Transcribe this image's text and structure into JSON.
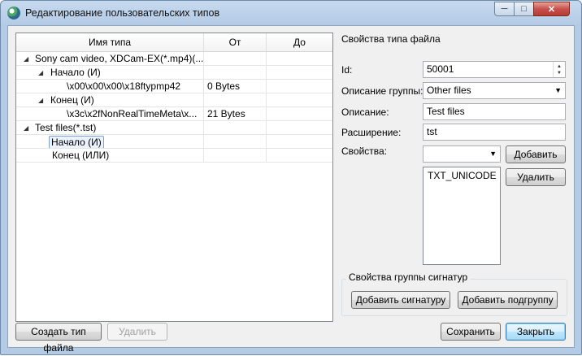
{
  "window": {
    "title": "Редактирование пользовательских типов",
    "min_symbol": "─",
    "max_symbol": "□",
    "close_symbol": "✕"
  },
  "tree": {
    "columns": [
      "Имя типа",
      "От",
      "До"
    ],
    "rows": [
      {
        "name": "Sony cam video, XDCam-EX(*.mp4)(...",
        "from": "",
        "to": "",
        "indent": 0,
        "expanded": true
      },
      {
        "name": "Начало (И)",
        "from": "",
        "to": "",
        "indent": 1,
        "expanded": true
      },
      {
        "name": "\\x00\\x00\\x00\\x18ftypmp42",
        "from": "0 Bytes",
        "to": "",
        "indent": 2
      },
      {
        "name": "Конец (И)",
        "from": "",
        "to": "",
        "indent": 1,
        "expanded": true
      },
      {
        "name": "\\x3c\\x2fNonRealTimeMeta\\x...",
        "from": "21 Bytes",
        "to": "",
        "indent": 2
      },
      {
        "name": "Test files(*.tst)",
        "from": "",
        "to": "",
        "indent": 0,
        "expanded": true
      },
      {
        "name": "Начало (И)",
        "from": "",
        "to": "",
        "indent": 1,
        "selected": true
      },
      {
        "name": "Конец (ИЛИ)",
        "from": "",
        "to": "",
        "indent": 1
      }
    ]
  },
  "props": {
    "title": "Свойства типа файла",
    "id_label": "Id:",
    "id_value": "50001",
    "group_label": "Описание группы:",
    "group_value": "Other files",
    "desc_label": "Описание:",
    "desc_value": "Test files",
    "ext_label": "Расширение:",
    "ext_value": "tst",
    "props_label": "Свойства:",
    "props_value": "",
    "add_button": "Добавить",
    "remove_button": "Удалить",
    "list_items": [
      "TXT_UNICODE"
    ]
  },
  "signature_group": {
    "title": "Свойства группы сигнатур",
    "add_signature": "Добавить сигнатуру",
    "add_subgroup": "Добавить подгруппу"
  },
  "footer": {
    "create_type": "Создать тип файла",
    "delete": "Удалить",
    "save": "Сохранить",
    "close": "Закрыть"
  }
}
